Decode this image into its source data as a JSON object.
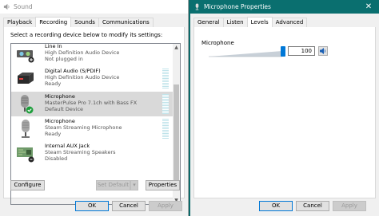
{
  "sound_window": {
    "title": "Sound",
    "tabs": [
      "Playback",
      "Recording",
      "Sounds",
      "Communications"
    ],
    "active_tab": "Recording",
    "instruction": "Select a recording device below to modify its settings:",
    "devices": [
      {
        "name": "Line In",
        "description": "High Definition Audio Device",
        "status": "Not plugged in",
        "icon": "line-in-jack-icon"
      },
      {
        "name": "Digital Audio (S/PDIF)",
        "description": "High Definition Audio Device",
        "status": "Ready",
        "icon": "spdif-box-icon"
      },
      {
        "name": "Microphone",
        "description": "MasterPulse Pro 7.1ch with Bass FX",
        "status": "Default Device",
        "icon": "microphone-default-icon",
        "selected": true
      },
      {
        "name": "Microphone",
        "description": "Steam Streaming Microphone",
        "status": "Ready",
        "icon": "microphone-icon"
      },
      {
        "name": "Internal AUX Jack",
        "description": "Steam Streaming Speakers",
        "status": "Disabled",
        "icon": "aux-board-icon"
      }
    ],
    "buttons": {
      "configure": "Configure",
      "set_default": "Set Default",
      "properties": "Properties",
      "ok": "OK",
      "cancel": "Cancel",
      "apply": "Apply"
    }
  },
  "mic_window": {
    "title": "Microphone Properties",
    "tabs": [
      "General",
      "Listen",
      "Levels",
      "Advanced"
    ],
    "active_tab": "Levels",
    "level_label": "Microphone",
    "level_value": "100",
    "level_fraction": 1.0,
    "buttons": {
      "ok": "OK",
      "cancel": "Cancel",
      "apply": "Apply"
    }
  },
  "colors": {
    "accent": "#0078d7",
    "title_bar_active": "#0a6f6f",
    "default_check": "#1e9e3c"
  }
}
